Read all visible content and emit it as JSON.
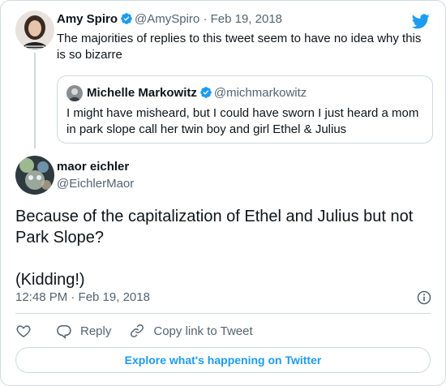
{
  "parent_tweet": {
    "author_name": "Amy Spiro",
    "author_handle": "@AmySpiro",
    "separator": "·",
    "date": "Feb 19, 2018",
    "text": "The majorities of replies to this tweet seem to have no idea why this is so bizarre",
    "verified": true
  },
  "quoted_tweet": {
    "author_name": "Michelle Markowitz",
    "author_handle": "@michmarkowitz",
    "verified": true,
    "text": "I might have misheard, but I could have sworn I just heard a mom in park slope call her twin boy and girl Ethel & Julius"
  },
  "main_tweet": {
    "author_name": "maor eichler",
    "author_handle": "@EichlerMaor",
    "text": "Because of the capitalization of Ethel and Julius but not Park Slope?\n\n(Kidding!)",
    "timestamp": "12:48 PM · Feb 19, 2018"
  },
  "actions": {
    "reply_label": "Reply",
    "copy_link_label": "Copy link to Tweet"
  },
  "explore_label": "Explore what's happening on Twitter",
  "colors": {
    "brand": "#1d9bf0",
    "like_icon": "#536471",
    "text_secondary": "#536471",
    "border": "#cfd9de"
  },
  "icons": [
    "twitter-bird-icon",
    "verified-badge-icon",
    "info-icon",
    "heart-icon",
    "reply-icon",
    "link-icon"
  ]
}
